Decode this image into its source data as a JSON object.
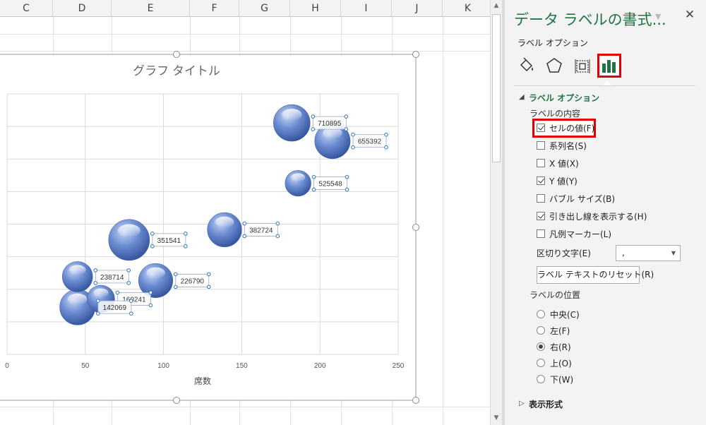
{
  "sheet": {
    "columns": [
      "C",
      "D",
      "E",
      "F",
      "G",
      "H",
      "I",
      "J",
      "K"
    ]
  },
  "chart_data": {
    "type": "scatter",
    "title": "グラフ タイトル",
    "xlabel": "席数",
    "ylabel": "",
    "xlim": [
      0,
      250
    ],
    "ylim": [
      0,
      800000
    ],
    "xticks": [
      "0",
      "50",
      "100",
      "150",
      "200",
      "250"
    ],
    "series": [
      {
        "bubble": true,
        "points": [
          {
            "x": 182,
            "y": 710895,
            "size": 0.8,
            "label": "710895"
          },
          {
            "x": 208,
            "y": 655392,
            "size": 0.75,
            "label": "655392"
          },
          {
            "x": 186,
            "y": 525548,
            "size": 0.4,
            "label": "525548"
          },
          {
            "x": 139,
            "y": 382724,
            "size": 0.7,
            "label": "382724"
          },
          {
            "x": 78,
            "y": 351541,
            "size": 1.0,
            "label": "351541"
          },
          {
            "x": 45,
            "y": 238714,
            "size": 0.55,
            "label": "238714"
          },
          {
            "x": 95,
            "y": 226790,
            "size": 0.7,
            "label": "226790"
          },
          {
            "x": 60,
            "y": 170241,
            "size": 0.45,
            "label": "160241"
          },
          {
            "x": 45,
            "y": 145000,
            "size": 0.75,
            "label": "142069"
          }
        ]
      }
    ]
  },
  "panel": {
    "title": "データ ラベルの書式...",
    "tab_label": "ラベル オプション",
    "section_title": "ラベル オプション",
    "contents_head": "ラベルの内容",
    "checkboxes": [
      {
        "label": "セルの値(F)",
        "checked": true
      },
      {
        "label": "系列名(S)",
        "checked": false
      },
      {
        "label": "X 値(X)",
        "checked": false
      },
      {
        "label": "Y 値(Y)",
        "checked": true
      },
      {
        "label": "バブル サイズ(B)",
        "checked": false
      },
      {
        "label": "引き出し線を表示する(H)",
        "checked": true
      },
      {
        "label": "凡例マーカー(L)",
        "checked": false
      }
    ],
    "separator_label": "区切り文字(E)",
    "separator_value": ",",
    "reset_button": "ラベル テキストのリセット(R)",
    "position_head": "ラベルの位置",
    "positions": [
      {
        "label": "中央(C)",
        "selected": false
      },
      {
        "label": "左(F)",
        "selected": false
      },
      {
        "label": "右(R)",
        "selected": true
      },
      {
        "label": "上(O)",
        "selected": false
      },
      {
        "label": "下(W)",
        "selected": false
      }
    ],
    "number_section": "表示形式",
    "accent_color": "#217346",
    "highlight_color": "#e00000"
  }
}
